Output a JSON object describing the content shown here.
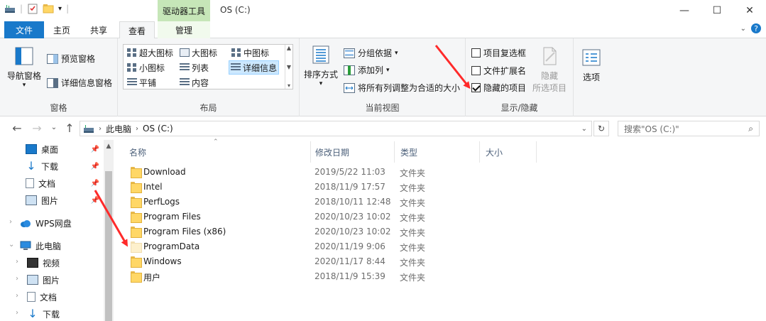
{
  "titlebar": {
    "context_tab": "驱动器工具",
    "title": "OS (C:)",
    "minimize": "—",
    "maximize": "☐",
    "close": "✕"
  },
  "tabs": [
    {
      "label": "文件"
    },
    {
      "label": "主页"
    },
    {
      "label": "共享"
    },
    {
      "label": "查看"
    },
    {
      "label": "管理"
    }
  ],
  "ribbon": {
    "panes": {
      "label": "窗格",
      "nav_pane": "导航窗格",
      "preview_pane": "预览窗格",
      "details_pane": "详细信息窗格"
    },
    "layout": {
      "label": "布局",
      "items": [
        "超大图标",
        "大图标",
        "中图标",
        "小图标",
        "列表",
        "详细信息",
        "平铺",
        "内容"
      ]
    },
    "current_view": {
      "label": "当前视图",
      "sort_by": "排序方式",
      "group_by": "分组依据",
      "add_column": "添加列",
      "fit_columns": "将所有列调整为合适的大小"
    },
    "show_hide": {
      "label": "显示/隐藏",
      "item_checkboxes": "项目复选框",
      "file_extensions": "文件扩展名",
      "hidden_items": "隐藏的项目",
      "hide_selected_1": "隐藏",
      "hide_selected_2": "所选项目",
      "options": "选项"
    }
  },
  "address": {
    "crumb_1": "此电脑",
    "crumb_2": "OS (C:)",
    "search_placeholder": "搜索\"OS (C:)\""
  },
  "nav": {
    "desktop": "桌面",
    "downloads": "下载",
    "documents": "文档",
    "pictures": "图片",
    "wps": "WPS网盘",
    "this_pc": "此电脑",
    "videos": "视频",
    "pictures2": "图片",
    "documents2": "文档",
    "downloads2": "下载"
  },
  "columns": {
    "name": "名称",
    "date": "修改日期",
    "type": "类型",
    "size": "大小"
  },
  "files": [
    {
      "name": "Download",
      "date": "2019/5/22 11:03",
      "type": "文件夹"
    },
    {
      "name": "Intel",
      "date": "2018/11/9 17:57",
      "type": "文件夹"
    },
    {
      "name": "PerfLogs",
      "date": "2018/10/11 12:48",
      "type": "文件夹"
    },
    {
      "name": "Program Files",
      "date": "2020/10/23 10:02",
      "type": "文件夹"
    },
    {
      "name": "Program Files (x86)",
      "date": "2020/10/23 10:02",
      "type": "文件夹"
    },
    {
      "name": "ProgramData",
      "date": "2020/11/19 9:06",
      "type": "文件夹"
    },
    {
      "name": "Windows",
      "date": "2020/11/17 8:44",
      "type": "文件夹"
    },
    {
      "name": "用户",
      "date": "2018/11/9 15:39",
      "type": "文件夹"
    }
  ],
  "colors": {
    "file_tab": "#1979ca",
    "context_tab": "#c6e6b8",
    "annotation_arrow": "#ff2a2a"
  }
}
